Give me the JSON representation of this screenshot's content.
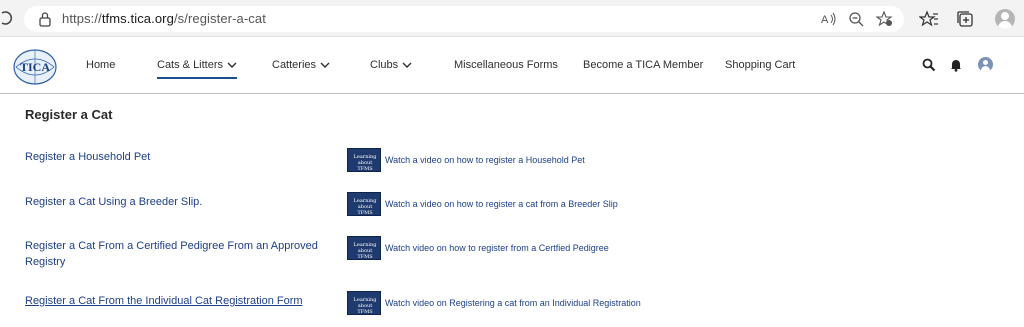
{
  "browser": {
    "url_prefix": "https://",
    "url_host": "tfms.tica.org",
    "url_path": "/s/register-a-cat",
    "icons": [
      "reload-icon",
      "lock-icon",
      "read-aloud-icon",
      "zoom-out-icon",
      "favorite-star-icon",
      "favorites-icon",
      "collections-icon",
      "profile-icon"
    ]
  },
  "header": {
    "logo_text": "TICA",
    "nav": [
      {
        "label": "Home"
      },
      {
        "label": "Cats & Litters",
        "dropdown": true,
        "active": true
      },
      {
        "label": "Catteries",
        "dropdown": true
      },
      {
        "label": "Clubs",
        "dropdown": true
      },
      {
        "label": "Miscellaneous Forms"
      },
      {
        "label": "Become a TICA Member"
      },
      {
        "label": "Shopping Cart"
      }
    ],
    "icons": [
      "search-icon",
      "bell-icon",
      "user-icon"
    ]
  },
  "page": {
    "title": "Register a Cat",
    "entries": [
      {
        "link": "Register a Household Pet",
        "video_thumb_text": "Learning about TFMS",
        "video_label": "Watch a video on how to register a Household Pet"
      },
      {
        "link": "Register a Cat Using a Breeder Slip.",
        "video_thumb_text": "Learning about TFMS",
        "video_label": "Watch a video on how to register a cat from a Breeder Slip"
      },
      {
        "link": "Register a Cat From a Certified Pedigree From an Approved Registry",
        "video_thumb_text": "Learning about TFMS",
        "video_label": "Watch video  on how to register from a Certfied Pedigree"
      },
      {
        "link": "Register a Cat From the Individual Cat Registration Form",
        "video_thumb_text": "Learning about TFMS",
        "video_label": "Watch video on Registering a cat from an Individual Registration"
      }
    ]
  },
  "colors": {
    "link": "#1d3f8a",
    "active_underline": "#1d4f8f",
    "thumb_bg": "#1f3a6e"
  }
}
